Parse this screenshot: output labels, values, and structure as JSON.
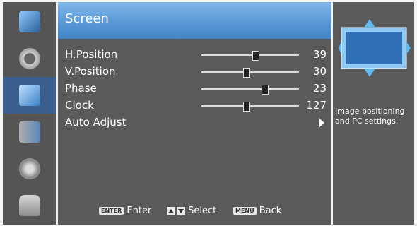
{
  "menu": {
    "title": "Screen",
    "items": [
      {
        "label": "H.Position",
        "value": "39",
        "level": 0.55
      },
      {
        "label": "V.Position",
        "value": "30",
        "level": 0.45
      },
      {
        "label": "Phase",
        "value": "23",
        "level": 0.65
      },
      {
        "label": "Clock",
        "value": "127",
        "level": 0.45
      },
      {
        "label": "Auto Adjust"
      }
    ]
  },
  "footer": {
    "enter_key": "ENTER",
    "enter_label": "Enter",
    "select_label": "Select",
    "menu_key": "MENU",
    "back_label": "Back"
  },
  "info": {
    "description": "Image positioning and PC settings."
  },
  "sidebar": {
    "icons": [
      "picture-icon",
      "audio-icon",
      "screen-icon",
      "setup-icon",
      "options-icon",
      "lock-icon"
    ],
    "active_index": 2
  },
  "colors": {
    "accent": "#3f83c6",
    "panel": "#5a5a5a"
  }
}
